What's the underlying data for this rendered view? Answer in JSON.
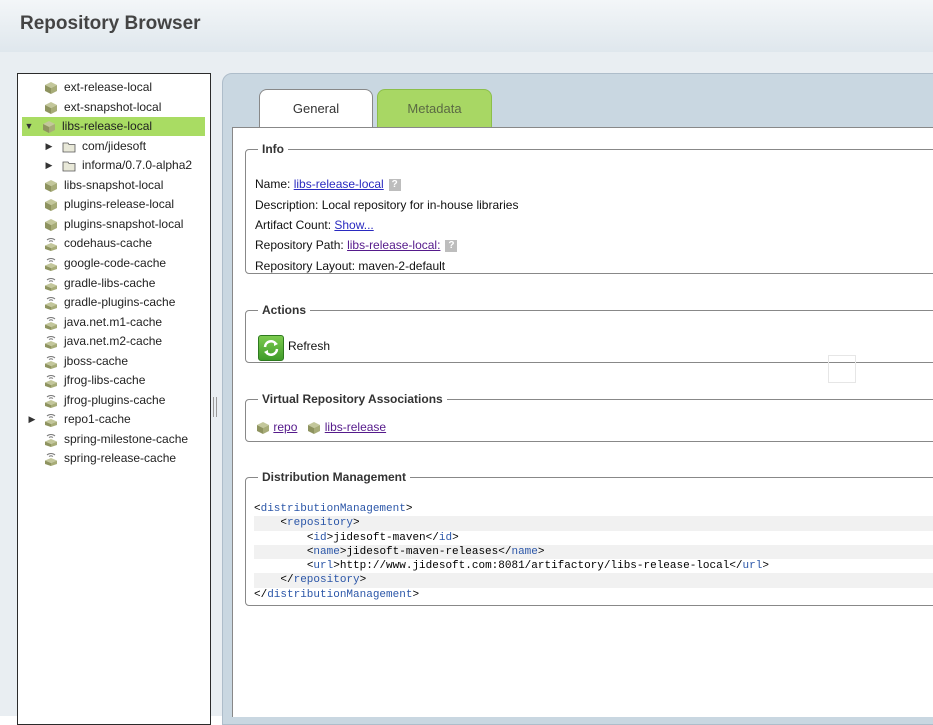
{
  "header": {
    "title": "Repository Browser"
  },
  "tree": {
    "items": [
      {
        "label": "ext-release-local",
        "icon": "repo-cube-icon",
        "arrow": ""
      },
      {
        "label": "ext-snapshot-local",
        "icon": "repo-cube-icon",
        "arrow": ""
      },
      {
        "label": "libs-release-local",
        "icon": "repo-cube-icon",
        "arrow": "▼",
        "selected": true
      },
      {
        "label": "com/jidesoft",
        "icon": "folder-icon",
        "arrow": "▶",
        "child": true
      },
      {
        "label": "informa/0.7.0-alpha2",
        "icon": "folder-icon",
        "arrow": "▶",
        "child": true
      },
      {
        "label": "libs-snapshot-local",
        "icon": "repo-cube-icon",
        "arrow": ""
      },
      {
        "label": "plugins-release-local",
        "icon": "repo-cube-icon",
        "arrow": ""
      },
      {
        "label": "plugins-snapshot-local",
        "icon": "repo-cube-icon",
        "arrow": ""
      },
      {
        "label": "codehaus-cache",
        "icon": "remote-cube-icon",
        "arrow": ""
      },
      {
        "label": "google-code-cache",
        "icon": "remote-cube-icon",
        "arrow": ""
      },
      {
        "label": "gradle-libs-cache",
        "icon": "remote-cube-icon",
        "arrow": ""
      },
      {
        "label": "gradle-plugins-cache",
        "icon": "remote-cube-icon",
        "arrow": ""
      },
      {
        "label": "java.net.m1-cache",
        "icon": "remote-cube-icon",
        "arrow": ""
      },
      {
        "label": "java.net.m2-cache",
        "icon": "remote-cube-icon",
        "arrow": ""
      },
      {
        "label": "jboss-cache",
        "icon": "remote-cube-icon",
        "arrow": ""
      },
      {
        "label": "jfrog-libs-cache",
        "icon": "remote-cube-icon",
        "arrow": ""
      },
      {
        "label": "jfrog-plugins-cache",
        "icon": "remote-cube-icon",
        "arrow": ""
      },
      {
        "label": "repo1-cache",
        "icon": "remote-cube-icon",
        "arrow": "▶"
      },
      {
        "label": "spring-milestone-cache",
        "icon": "remote-cube-icon",
        "arrow": ""
      },
      {
        "label": "spring-release-cache",
        "icon": "remote-cube-icon",
        "arrow": ""
      }
    ]
  },
  "tabs": {
    "general": "General",
    "metadata": "Metadata"
  },
  "info": {
    "legend": "Info",
    "name_label": "Name:",
    "name_value": "libs-release-local",
    "description_label": "Description:",
    "description_value": "Local repository for in-house libraries",
    "artifact_count_label": "Artifact Count:",
    "artifact_count_link": "Show...",
    "path_label": "Repository Path:",
    "path_value": "libs-release-local:",
    "layout_label": "Repository Layout:",
    "layout_value": "maven-2-default",
    "help_glyph": "?"
  },
  "actions": {
    "legend": "Actions",
    "refresh_label": "Refresh"
  },
  "virtual": {
    "legend": "Virtual Repository Associations",
    "links": [
      "repo",
      "libs-release"
    ]
  },
  "distribution": {
    "legend": "Distribution Management",
    "lines": [
      {
        "indent": "",
        "open": "<",
        "tag": "distributionManagement",
        "close": ">",
        "text": "",
        "tag2": ""
      },
      {
        "indent": "    ",
        "open": "<",
        "tag": "repository",
        "close": ">",
        "text": "",
        "tag2": ""
      },
      {
        "indent": "        ",
        "open": "<",
        "tag": "id",
        "close": ">",
        "text": "jidesoft-maven",
        "tag2": "id"
      },
      {
        "indent": "        ",
        "open": "<",
        "tag": "name",
        "close": ">",
        "text": "jidesoft-maven-releases",
        "tag2": "name"
      },
      {
        "indent": "        ",
        "open": "<",
        "tag": "url",
        "close": ">",
        "text": "http://www.jidesoft.com:8081/artifactory/libs-release-local",
        "tag2": "url"
      },
      {
        "indent": "    ",
        "open": "</",
        "tag": "repository",
        "close": ">",
        "text": "",
        "tag2": ""
      },
      {
        "indent": "",
        "open": "</",
        "tag": "distributionManagement",
        "close": ">",
        "text": "",
        "tag2": ""
      }
    ]
  }
}
